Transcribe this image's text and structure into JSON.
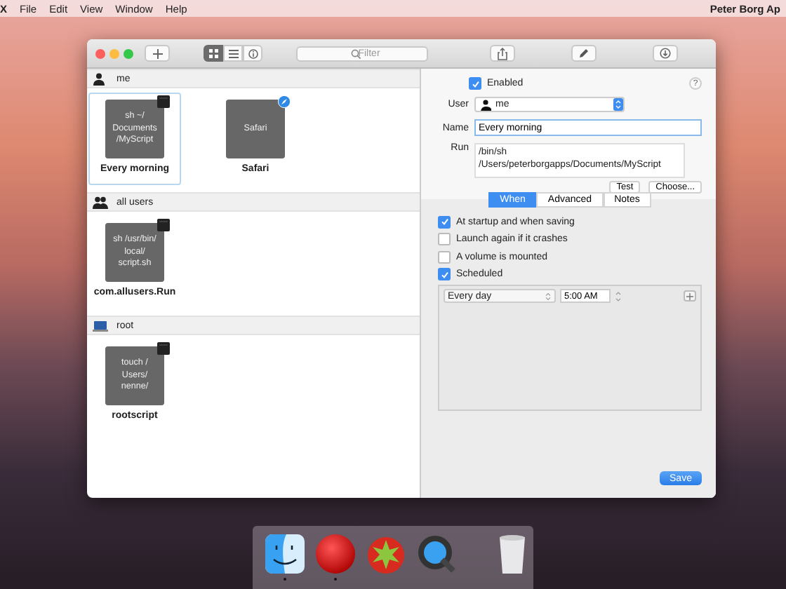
{
  "menu_bar": {
    "items": [
      "X",
      "File",
      "Edit",
      "View",
      "Window",
      "Help"
    ],
    "user": "Peter Borg Ap"
  },
  "toolbar": {
    "view_modes": [
      {
        "kind": "grid",
        "selected": true
      },
      {
        "kind": "list",
        "selected": false
      },
      {
        "kind": "info",
        "selected": false
      }
    ],
    "search": {
      "placeholder": "Filter"
    }
  },
  "groups": [
    {
      "title": "me",
      "kind": "user",
      "items": [
        {
          "label": "Every morning",
          "tile": "sh ~/\nDocuments\n/MyScript",
          "kind": "terminal",
          "selected": true
        },
        {
          "label": "Safari",
          "tile": "Safari",
          "kind": "safari",
          "selected": false
        }
      ]
    },
    {
      "title": "all users",
      "kind": "group",
      "items": [
        {
          "label": "com.allusers.Run",
          "tile": "sh /usr/bin/\nlocal/\nscript.sh",
          "kind": "terminal",
          "selected": false
        }
      ]
    },
    {
      "title": "root",
      "kind": "root",
      "items": [
        {
          "label": "rootscript",
          "tile": "touch /\nUsers/\nnenne/",
          "kind": "terminal",
          "selected": false
        }
      ]
    }
  ],
  "detail": {
    "enabled": {
      "label": "Enabled",
      "checked": true
    },
    "help": "?",
    "user_label": "User",
    "user": "me",
    "name_label": "Name",
    "name": "Every morning",
    "run_label": "Run",
    "run": "/bin/sh /Users/peterborgapps/Documents/MyScript",
    "buttons": [
      "Test",
      "Choose..."
    ],
    "tabs": [
      {
        "label": "When",
        "selected": true
      },
      {
        "label": "Advanced",
        "selected": false
      },
      {
        "label": "Notes",
        "selected": false
      }
    ],
    "triggers": [
      {
        "label": "At startup and when saving",
        "checked": true
      },
      {
        "label": "Launch again if it crashes",
        "checked": false
      },
      {
        "label": "A volume is mounted",
        "checked": false
      },
      {
        "label": "Scheduled",
        "checked": true
      }
    ],
    "schedule": {
      "frequency": "Every day",
      "time": "5:00 AM"
    },
    "save": "Save"
  },
  "dock": [
    {
      "kind": "finder",
      "running": true
    },
    {
      "kind": "ball",
      "running": true
    },
    {
      "kind": "tomato",
      "running": false
    },
    {
      "kind": "quicktime",
      "running": false
    },
    {
      "kind": "trash",
      "running": false
    }
  ]
}
